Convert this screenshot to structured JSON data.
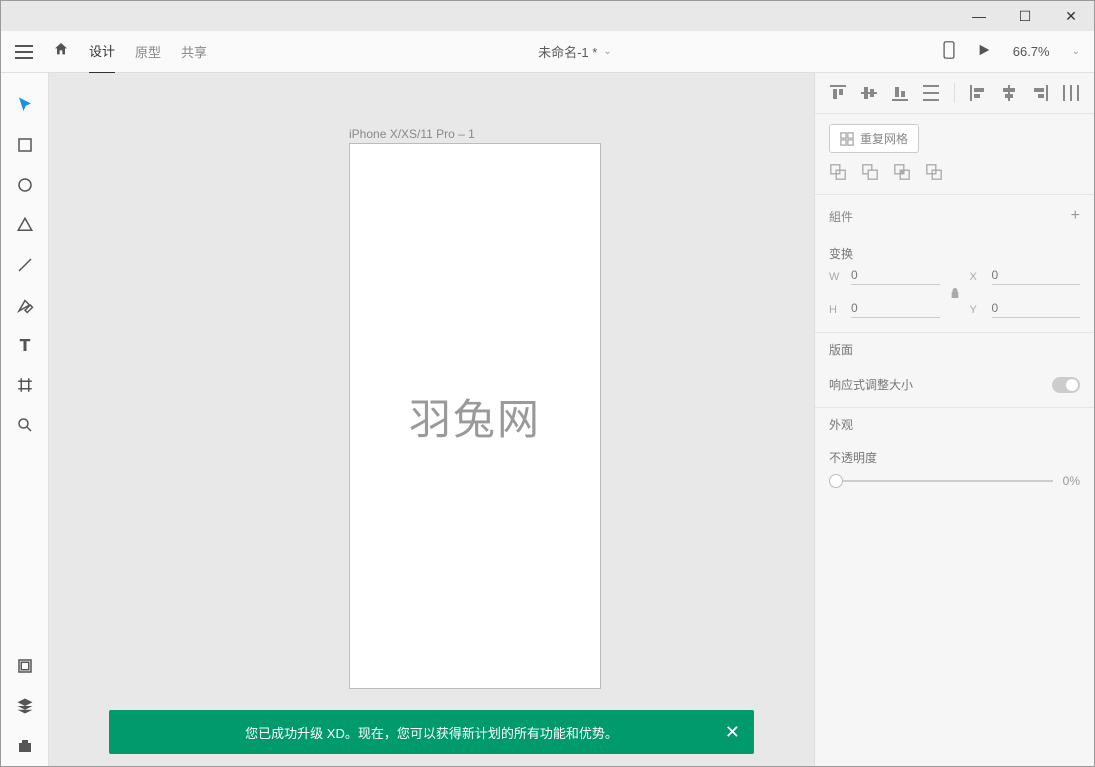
{
  "window": {
    "minimize": "—",
    "maximize": "☐",
    "close": "✕"
  },
  "toolbar": {
    "tabs": {
      "design": "设计",
      "prototype": "原型",
      "share": "共享"
    },
    "doc_title": "未命名-1 *",
    "zoom": "66.7%"
  },
  "canvas": {
    "artboard_label": "iPhone X/XS/11 Pro – 1",
    "watermark": "羽兔网"
  },
  "panel": {
    "repeat_grid": "重复网格",
    "component": "組件",
    "transform": {
      "title": "变换",
      "w_label": "W",
      "w": "0",
      "h_label": "H",
      "h": "0",
      "x_label": "X",
      "x": "0",
      "y_label": "Y",
      "y": "0"
    },
    "layout": {
      "title": "版面",
      "responsive": "响应式调整大小"
    },
    "appearance": {
      "title": "外观",
      "opacity_label": "不透明度",
      "opacity_value": "0%"
    }
  },
  "toast": {
    "message": "您已成功升级 XD。现在，您可以获得新计划的所有功能和优势。",
    "close": "✕"
  }
}
